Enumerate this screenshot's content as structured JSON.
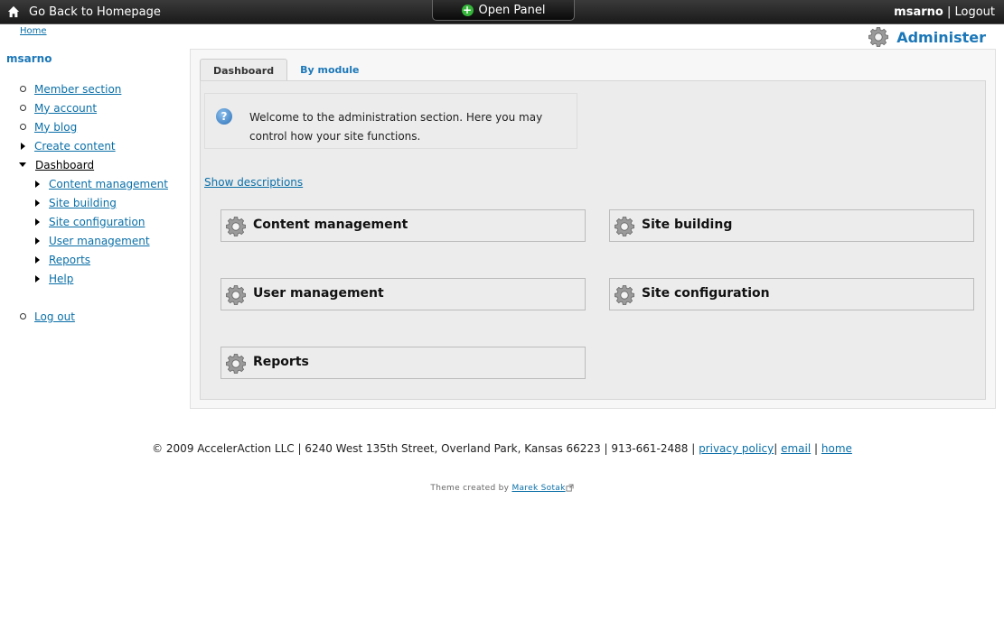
{
  "topbar": {
    "home_label": "Go Back to Homepage",
    "open_panel_label": "Open Panel",
    "username": "msarno",
    "separator": " | ",
    "logout_label": "Logout"
  },
  "breadcrumb": {
    "home": "Home"
  },
  "page_title": "Administer",
  "sidebar": {
    "user": "msarno",
    "items": [
      {
        "label": "Member section"
      },
      {
        "label": "My account"
      },
      {
        "label": "My blog"
      },
      {
        "label": "Create content"
      },
      {
        "label": "Dashboard"
      }
    ],
    "sub_items": [
      {
        "label": "Content management"
      },
      {
        "label": "Site building"
      },
      {
        "label": "Site configuration"
      },
      {
        "label": "User management"
      },
      {
        "label": "Reports"
      },
      {
        "label": "Help"
      }
    ],
    "logout": "Log out"
  },
  "tabs": [
    {
      "label": "Dashboard"
    },
    {
      "label": "By module"
    }
  ],
  "help": {
    "icon": "question-icon",
    "text": "Welcome to the administration section. Here you may control how your site functions."
  },
  "show_descriptions": "Show descriptions",
  "blocks": [
    {
      "title": "Content management"
    },
    {
      "title": "Site building"
    },
    {
      "title": "User management"
    },
    {
      "title": "Site configuration"
    },
    {
      "title": "Reports"
    }
  ],
  "footer": {
    "text": "© 2009 AccelerAction LLC | 6240 West 135th Street, Overland Park, Kansas 66223 | 913-661-2488 | ",
    "privacy": "privacy policy",
    "sep1": "| ",
    "email": "email",
    "sep2": " | ",
    "home": "home"
  },
  "credit": {
    "prefix": "Theme created by ",
    "author": "Marek Sotak"
  },
  "colors": {
    "accent": "#1b77b8",
    "link": "#0a6fa8",
    "topbar": "#1a1a1a",
    "plus": "#35b53a"
  }
}
